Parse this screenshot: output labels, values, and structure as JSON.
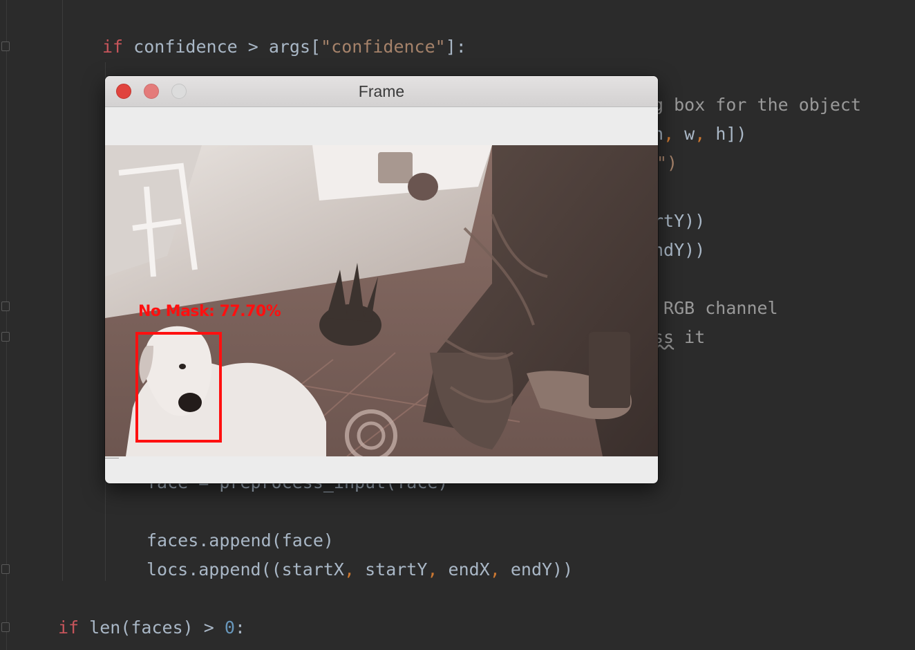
{
  "editor": {
    "lines": [
      {
        "id": "l1",
        "parts": [
          [
            "kw2",
            "if"
          ],
          [
            "plain",
            " confidence > args["
          ],
          [
            "str",
            "\"confidence\""
          ],
          [
            "plain",
            "]:"
          ]
        ]
      },
      {
        "id": "l2",
        "parts": [
          [
            "cmt",
            "g box for the object"
          ]
        ]
      },
      {
        "id": "l3",
        "parts": [
          [
            "plain",
            "h"
          ],
          [
            "punc",
            ","
          ],
          [
            "plain",
            " w"
          ],
          [
            "punc",
            ","
          ],
          [
            "plain",
            " h])"
          ]
        ]
      },
      {
        "id": "l4",
        "parts": [
          [
            "str",
            "\")"
          ]
        ]
      },
      {
        "id": "l5",
        "parts": [
          [
            "plain",
            "rtY))"
          ]
        ]
      },
      {
        "id": "l6",
        "parts": [
          [
            "plain",
            "ndY))"
          ]
        ]
      },
      {
        "id": "l7",
        "parts": [
          [
            "cmt",
            " RGB channel"
          ]
        ]
      },
      {
        "id": "l8",
        "parts": [
          [
            "cmt",
            "ss"
          ],
          [
            "cmt",
            " it"
          ]
        ]
      },
      {
        "id": "l9",
        "parts": [
          [
            "plain",
            "face = preprocess_input(face)"
          ]
        ]
      },
      {
        "id": "l10",
        "parts": [
          [
            "plain",
            "faces.append(face)"
          ]
        ]
      },
      {
        "id": "l11",
        "parts": [
          [
            "plain",
            "locs.append((startX"
          ],
          [
            "punc",
            ","
          ],
          [
            "plain",
            " startY"
          ],
          [
            "punc",
            ","
          ],
          [
            "plain",
            " endX"
          ],
          [
            "punc",
            ","
          ],
          [
            "plain",
            " endY))"
          ]
        ]
      },
      {
        "id": "l12",
        "parts": [
          [
            "kw2",
            "if"
          ],
          [
            "plain",
            " len(faces) > "
          ],
          [
            "num",
            "0"
          ],
          [
            "plain",
            ":"
          ]
        ]
      }
    ]
  },
  "window": {
    "title": "Frame",
    "detection_label": "No Mask: 77.70%",
    "detection_color": "#ff1010"
  }
}
